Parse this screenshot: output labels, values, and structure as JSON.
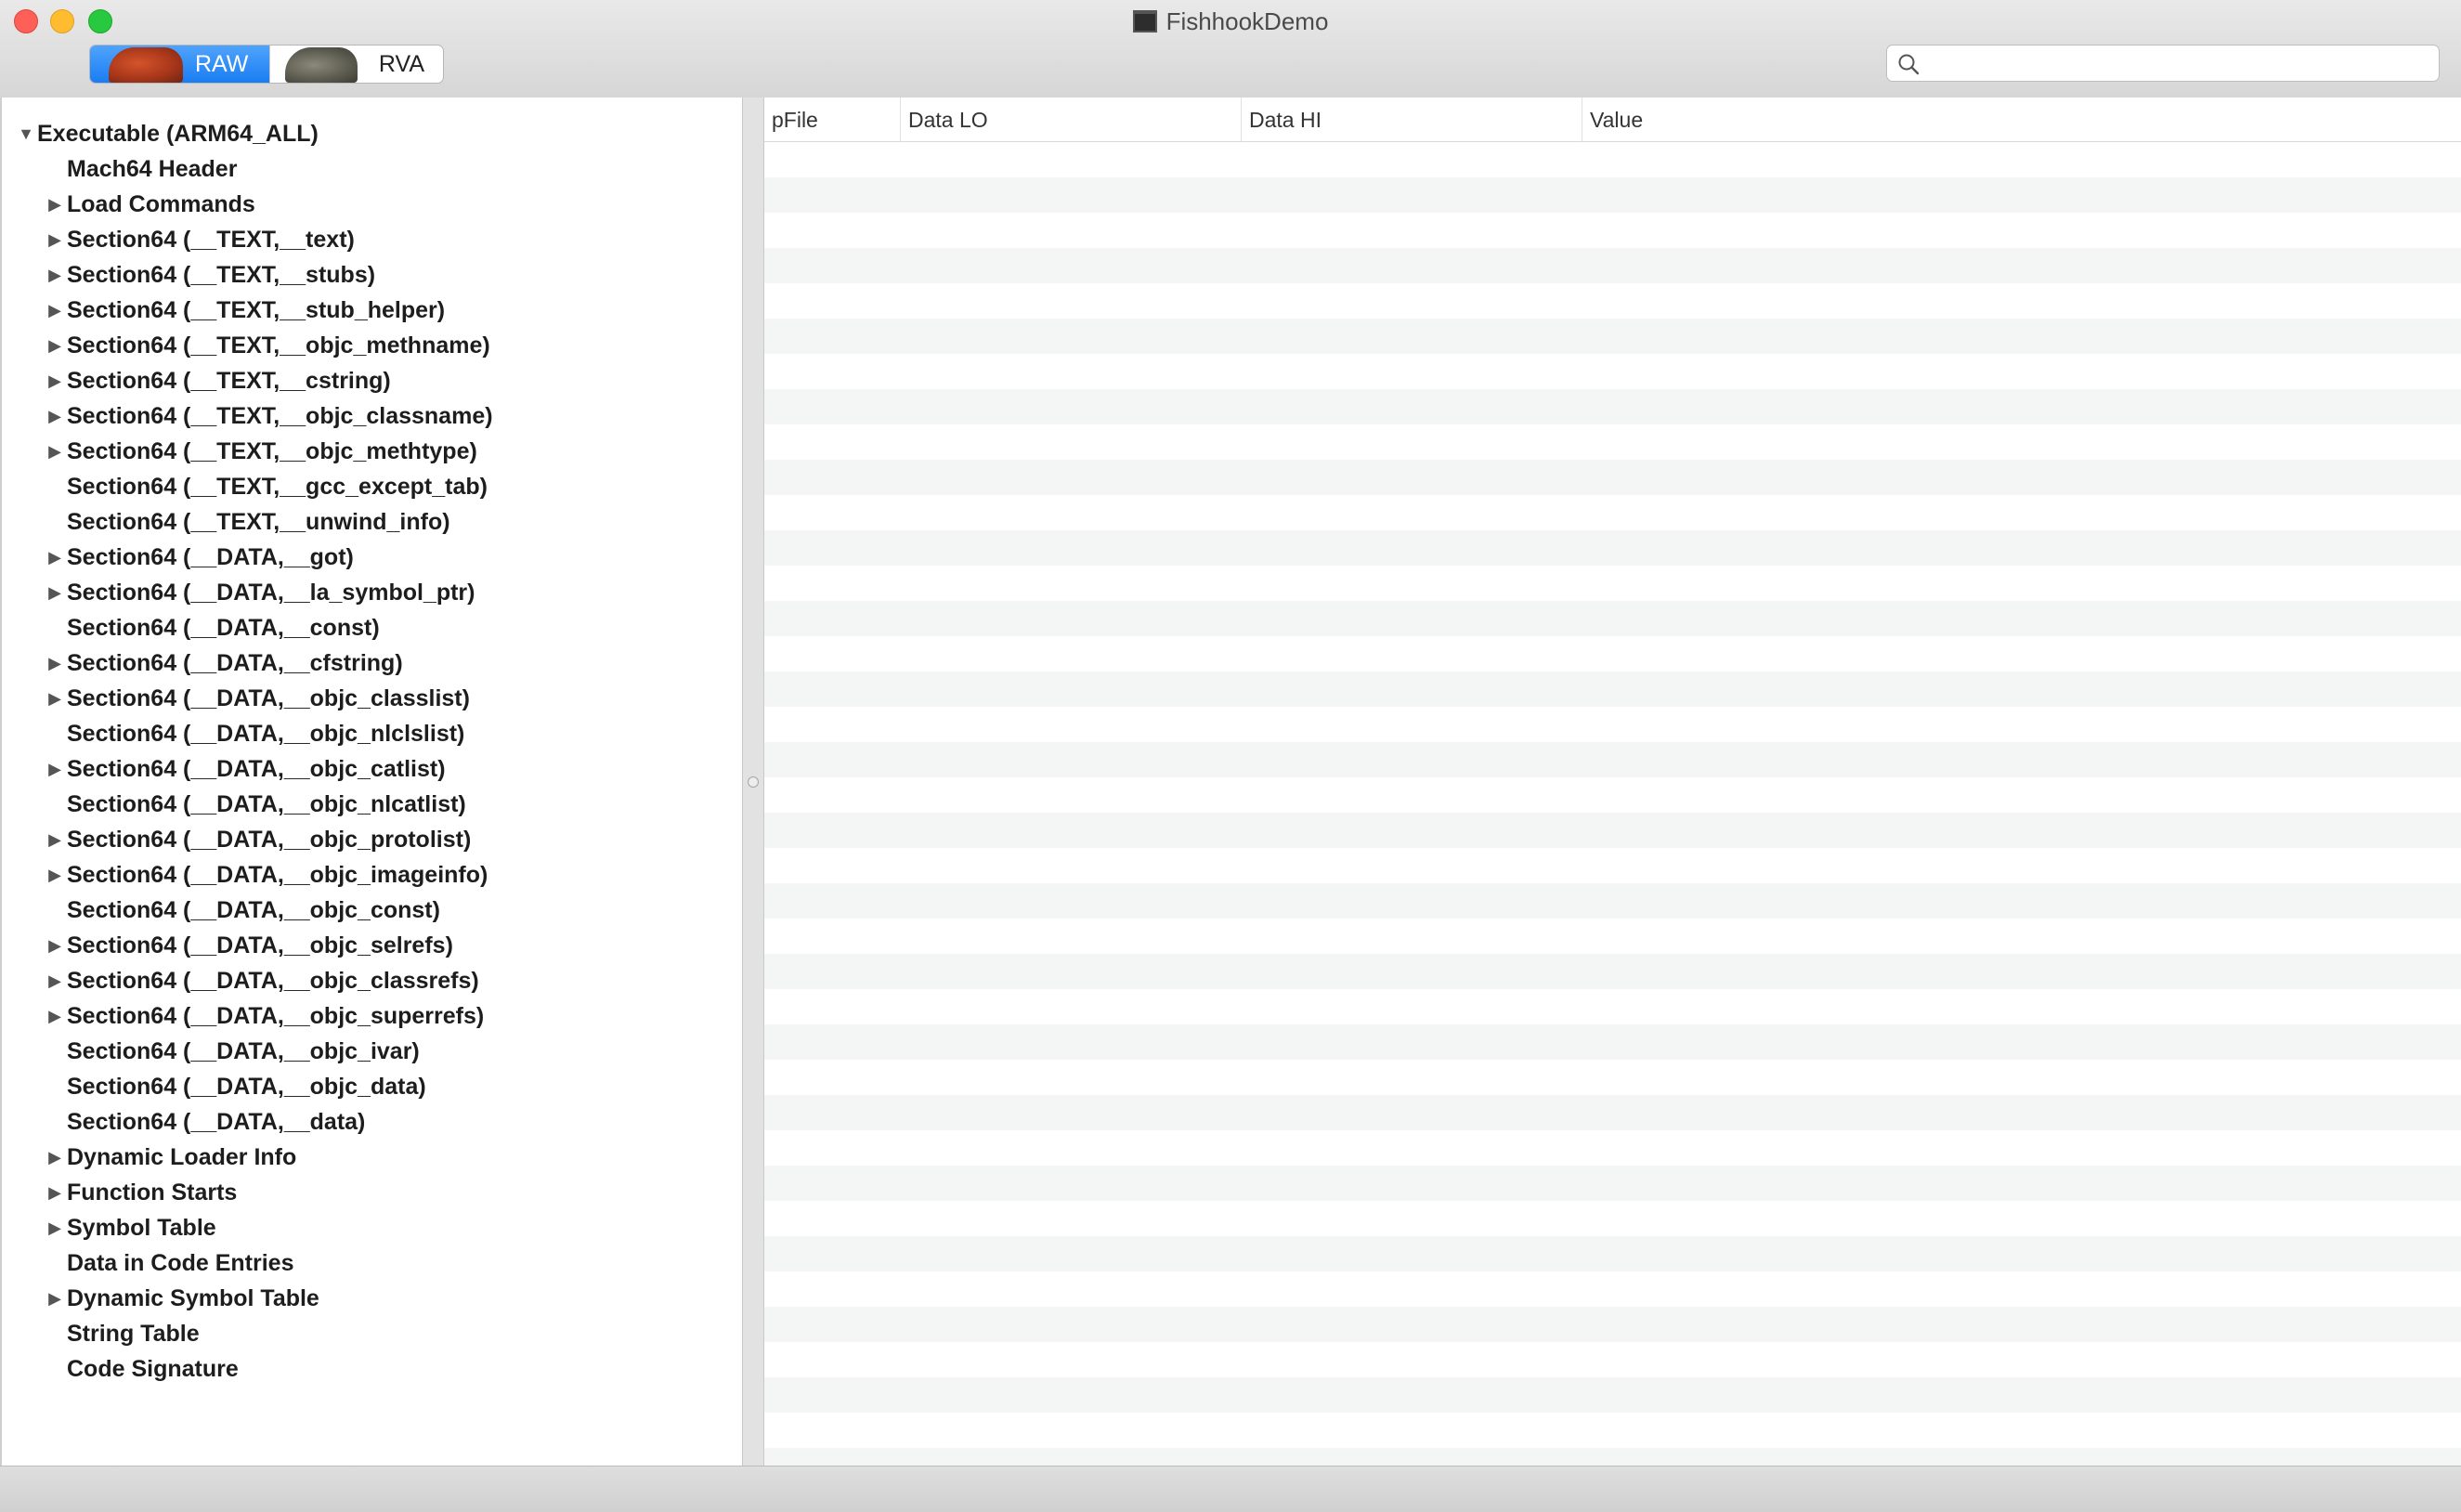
{
  "window": {
    "title": "FishhookDemo"
  },
  "toolbar": {
    "raw_label": "RAW",
    "rva_label": "RVA",
    "search_placeholder": ""
  },
  "table": {
    "columns": [
      "pFile",
      "Data LO",
      "Data HI",
      "Value"
    ]
  },
  "tree": {
    "items": [
      {
        "label": "Executable  (ARM64_ALL)",
        "arrow": "expanded"
      },
      {
        "label": "Mach64 Header",
        "arrow": "none"
      },
      {
        "label": "Load Commands",
        "arrow": "collapsed"
      },
      {
        "label": "Section64 (__TEXT,__text)",
        "arrow": "collapsed"
      },
      {
        "label": "Section64 (__TEXT,__stubs)",
        "arrow": "collapsed"
      },
      {
        "label": "Section64 (__TEXT,__stub_helper)",
        "arrow": "collapsed"
      },
      {
        "label": "Section64 (__TEXT,__objc_methname)",
        "arrow": "collapsed"
      },
      {
        "label": "Section64 (__TEXT,__cstring)",
        "arrow": "collapsed"
      },
      {
        "label": "Section64 (__TEXT,__objc_classname)",
        "arrow": "collapsed"
      },
      {
        "label": "Section64 (__TEXT,__objc_methtype)",
        "arrow": "collapsed"
      },
      {
        "label": "Section64 (__TEXT,__gcc_except_tab)",
        "arrow": "none"
      },
      {
        "label": "Section64 (__TEXT,__unwind_info)",
        "arrow": "none"
      },
      {
        "label": "Section64 (__DATA,__got)",
        "arrow": "collapsed"
      },
      {
        "label": "Section64 (__DATA,__la_symbol_ptr)",
        "arrow": "collapsed"
      },
      {
        "label": "Section64 (__DATA,__const)",
        "arrow": "none"
      },
      {
        "label": "Section64 (__DATA,__cfstring)",
        "arrow": "collapsed"
      },
      {
        "label": "Section64 (__DATA,__objc_classlist)",
        "arrow": "collapsed"
      },
      {
        "label": "Section64 (__DATA,__objc_nlclslist)",
        "arrow": "none"
      },
      {
        "label": "Section64 (__DATA,__objc_catlist)",
        "arrow": "collapsed"
      },
      {
        "label": "Section64 (__DATA,__objc_nlcatlist)",
        "arrow": "none"
      },
      {
        "label": "Section64 (__DATA,__objc_protolist)",
        "arrow": "collapsed"
      },
      {
        "label": "Section64 (__DATA,__objc_imageinfo)",
        "arrow": "collapsed"
      },
      {
        "label": "Section64 (__DATA,__objc_const)",
        "arrow": "none"
      },
      {
        "label": "Section64 (__DATA,__objc_selrefs)",
        "arrow": "collapsed"
      },
      {
        "label": "Section64 (__DATA,__objc_classrefs)",
        "arrow": "collapsed"
      },
      {
        "label": "Section64 (__DATA,__objc_superrefs)",
        "arrow": "collapsed"
      },
      {
        "label": "Section64 (__DATA,__objc_ivar)",
        "arrow": "none"
      },
      {
        "label": "Section64 (__DATA,__objc_data)",
        "arrow": "none"
      },
      {
        "label": "Section64 (__DATA,__data)",
        "arrow": "none"
      },
      {
        "label": "Dynamic Loader Info",
        "arrow": "collapsed"
      },
      {
        "label": "Function Starts",
        "arrow": "collapsed"
      },
      {
        "label": "Symbol Table",
        "arrow": "collapsed"
      },
      {
        "label": "Data in Code Entries",
        "arrow": "none"
      },
      {
        "label": "Dynamic Symbol Table",
        "arrow": "collapsed"
      },
      {
        "label": "String Table",
        "arrow": "none"
      },
      {
        "label": "Code Signature",
        "arrow": "none"
      }
    ]
  }
}
